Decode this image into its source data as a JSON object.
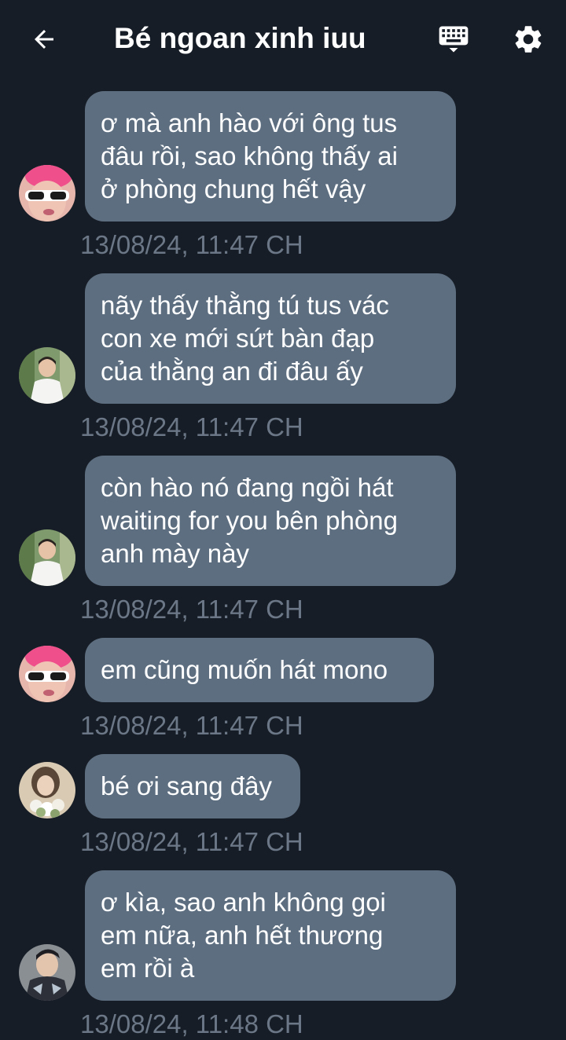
{
  "header": {
    "title": "Bé ngoan xinh iuu",
    "back_icon": "arrow-left-icon",
    "keyboard_icon": "keyboard-icon",
    "settings_icon": "gear-icon"
  },
  "colors": {
    "background": "#171d26",
    "bubble": "#5d6e80",
    "timestamp": "#6b7786",
    "text": "#ffffff"
  },
  "messages": [
    {
      "text": "ơ mà anh hào với ông tus\nđâu rồi, sao không thấy ai\nở phòng chung hết vậy",
      "time": "13/08/24, 11:47 CH",
      "avatar": "pink-hair-sunglasses-avatar"
    },
    {
      "text": "nãy thấy thằng tú tus vác\ncon xe mới sứt bàn đạp\ncủa thằng an đi đâu ấy",
      "time": "13/08/24, 11:47 CH",
      "avatar": "white-shirt-avatar"
    },
    {
      "text": "còn hào nó đang ngồi hát\nwaiting for you bên phòng\nanh mày này",
      "time": "13/08/24, 11:47 CH",
      "avatar": "white-shirt-avatar"
    },
    {
      "text": "em cũng muốn hát mono",
      "time": "13/08/24, 11:47 CH",
      "avatar": "pink-hair-sunglasses-avatar"
    },
    {
      "text": "bé ơi sang đây",
      "time": "13/08/24, 11:47 CH",
      "avatar": "flowers-avatar"
    },
    {
      "text": "ơ kìa, sao anh không gọi\nem nữa, anh hết thương\nem rồi à",
      "time": "13/08/24, 11:48 CH",
      "avatar": "dark-jacket-avatar"
    }
  ]
}
